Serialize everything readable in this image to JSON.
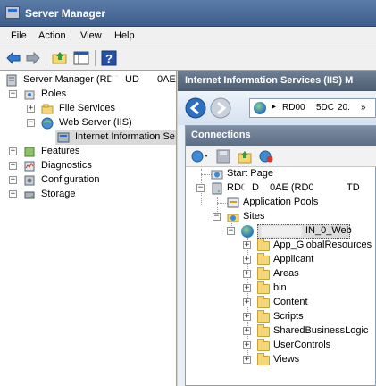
{
  "window": {
    "title": "Server Manager"
  },
  "menu": [
    "File",
    "Action",
    "View",
    "Help"
  ],
  "left_tree": {
    "root": "Server Manager (RD0",
    "root_suffix": "UD",
    "root_suffix2": "0AE",
    "roles": "Roles",
    "file_services": "File Services",
    "web_server": "Web Server (IIS)",
    "iis": "Internet Information Se",
    "features": "Features",
    "diagnostics": "Diagnostics",
    "configuration": "Configuration",
    "storage": "Storage"
  },
  "right": {
    "header": "Internet Information Services (IIS) M",
    "address": {
      "arrow": "▸",
      "segment": "RD00",
      "segment2": "5DC",
      "segment3": "20.",
      "more": "»"
    },
    "connections_title": "Connections",
    "tree": {
      "start_page": "Start Page",
      "server_prefix": "RD0",
      "server_mid": "D",
      "server_mid2": "0AE (RD0",
      "server_tail": "TD",
      "app_pools": "Application Pools",
      "sites": "Sites",
      "site_suffix": "IN_0_Web",
      "folders": [
        "App_GlobalResources",
        "Applicant",
        "Areas",
        "bin",
        "Content",
        "Scripts",
        "SharedBusinessLogic",
        "UserControls",
        "Views"
      ]
    }
  },
  "icons": [
    "server-manager-icon",
    "back-icon",
    "forward-icon",
    "up-folder-icon",
    "show-hide-tree-icon",
    "help-icon"
  ]
}
